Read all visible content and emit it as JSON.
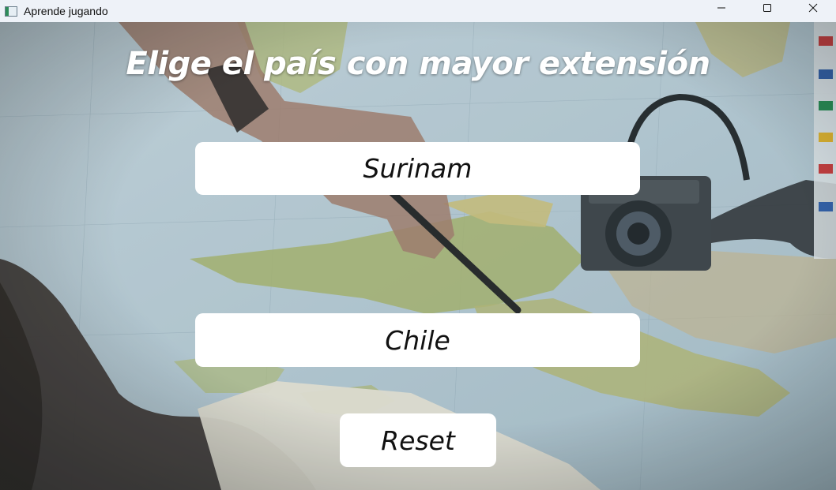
{
  "window": {
    "title": "Aprende jugando",
    "icon": "app-window-icon",
    "controls": {
      "minimize": "minimize-icon",
      "maximize": "maximize-icon",
      "close": "close-icon"
    }
  },
  "game": {
    "question": "Elige el país con mayor extensión",
    "options": [
      {
        "label": "Surinam"
      },
      {
        "label": "Chile"
      }
    ],
    "reset_label": "Reset"
  },
  "colors": {
    "titlebar": "#eef2f8",
    "button_bg": "#ffffff",
    "heading_text": "#ffffff",
    "button_text": "#111111"
  }
}
